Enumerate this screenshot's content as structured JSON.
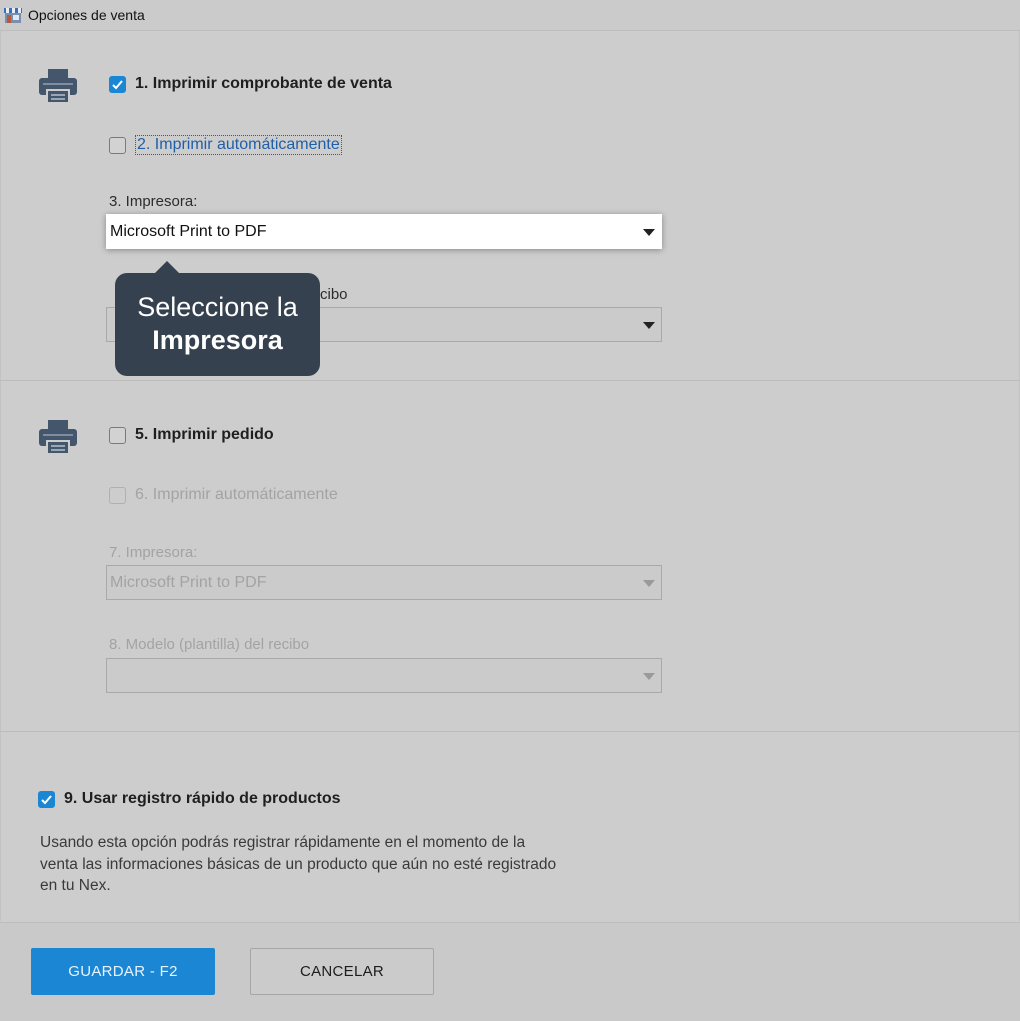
{
  "window": {
    "title": "Opciones de venta",
    "app_icon": "store-icon"
  },
  "section_sale": {
    "icon": "printer-icon",
    "print_receipt": {
      "label": "1. Imprimir comprobante de venta",
      "checked": true
    },
    "auto_print": {
      "label": "2. Imprimir automáticamente",
      "checked": false
    },
    "printer": {
      "label": "3. Impresora:",
      "value": "Microsoft Print to PDF"
    },
    "template": {
      "label_visible": "cibo",
      "value": ""
    }
  },
  "tooltip": {
    "line1": "Seleccione la",
    "line2": "Impresora"
  },
  "section_order": {
    "icon": "printer-icon",
    "print_order": {
      "label": "5. Imprimir pedido",
      "checked": false
    },
    "auto_print": {
      "label": "6. Imprimir automáticamente",
      "checked": false,
      "disabled": true
    },
    "printer": {
      "label": "7. Impresora:",
      "value": "Microsoft Print to PDF",
      "disabled": true
    },
    "template": {
      "label": "8. Modelo (plantilla) del recibo",
      "value": "",
      "disabled": true
    }
  },
  "quick_register": {
    "label": "9. Usar registro rápido de productos",
    "checked": true,
    "description": "Usando esta opción podrás registrar rápidamente en el momento de la venta las informaciones básicas de un producto que aún no esté registrado en tu Nex."
  },
  "footer": {
    "save_label": "GUARDAR - F2",
    "cancel_label": "CANCELAR"
  },
  "colors": {
    "accent": "#1a86d4",
    "tooltip_bg": "#364150",
    "background": "#cdcdcd"
  }
}
